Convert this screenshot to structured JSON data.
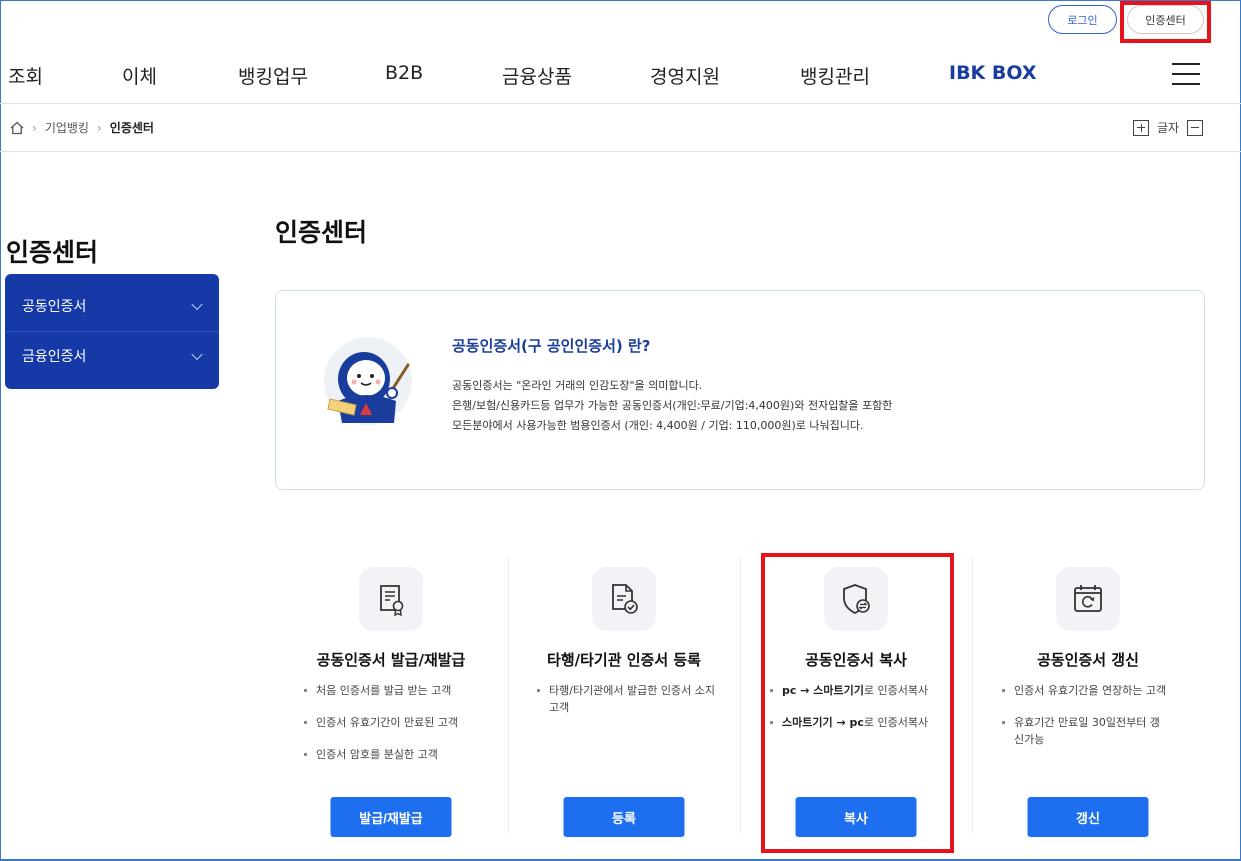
{
  "header": {
    "login_label": "로그인",
    "cert_center_label": "인증센터"
  },
  "gnb": {
    "items": [
      "조회",
      "이체",
      "뱅킹업무",
      "B2B",
      "금융상품",
      "경영지원",
      "뱅킹관리",
      "IBK BOX"
    ]
  },
  "breadcrumb": {
    "items": [
      "기업뱅킹",
      "인증센터"
    ]
  },
  "font_control": {
    "label": "글자"
  },
  "sidebar": {
    "title": "인증센터",
    "items": [
      {
        "label": "공동인증서"
      },
      {
        "label": "금융인증서"
      }
    ]
  },
  "main": {
    "title": "인증센터",
    "info": {
      "heading": "공동인증서(구 공인인증서) 란?",
      "lines": [
        "공동인증서는 \"온라인 거래의 인감도장\"을 의미합니다.",
        "은행/보험/신용카드등 업무가 가능한 공동인증서(개인:무료/기업:4,400원)와 전자입찰을 포함한",
        "모든분야에서 사용가능한 범용인증서 (개인: 4,400원 / 기업: 110,000원)로 나눠집니다."
      ]
    },
    "cards": [
      {
        "title": "공동인증서 발급/재발급",
        "icon": "certificate-ribbon-icon",
        "bullets": [
          "처음 인증서를 발급 받는 고객",
          "인증서 유효기간이 만료된 고객",
          "인증서 암호를 분실한 고객"
        ],
        "button": "발급/재발급"
      },
      {
        "title": "타행/타기관 인증서 등록",
        "icon": "document-check-icon",
        "bullets": [
          "타행/타기관에서 발급한 인증서 소지고객"
        ],
        "button": "등록"
      },
      {
        "title": "공동인증서 복사",
        "icon": "shield-transfer-icon",
        "bullets_rich": [
          {
            "b1": "pc",
            "arrow": " → ",
            "b2": "스마트기기",
            "rest": "로 인증서복사"
          },
          {
            "b1": "스마트기기",
            "arrow": " → ",
            "b2": "pc",
            "rest": "로 인증서복사"
          }
        ],
        "button": "복사"
      },
      {
        "title": "공동인증서 갱신",
        "icon": "calendar-refresh-icon",
        "bullets": [
          "인증서 유효기간을 연장하는 고객",
          "유효기간 만료일 30일전부터 갱신가능"
        ],
        "button": "갱신"
      }
    ]
  },
  "colors": {
    "brand_blue": "#1639a8",
    "button_blue": "#1d6ff0",
    "highlight_red": "#e8121a"
  }
}
